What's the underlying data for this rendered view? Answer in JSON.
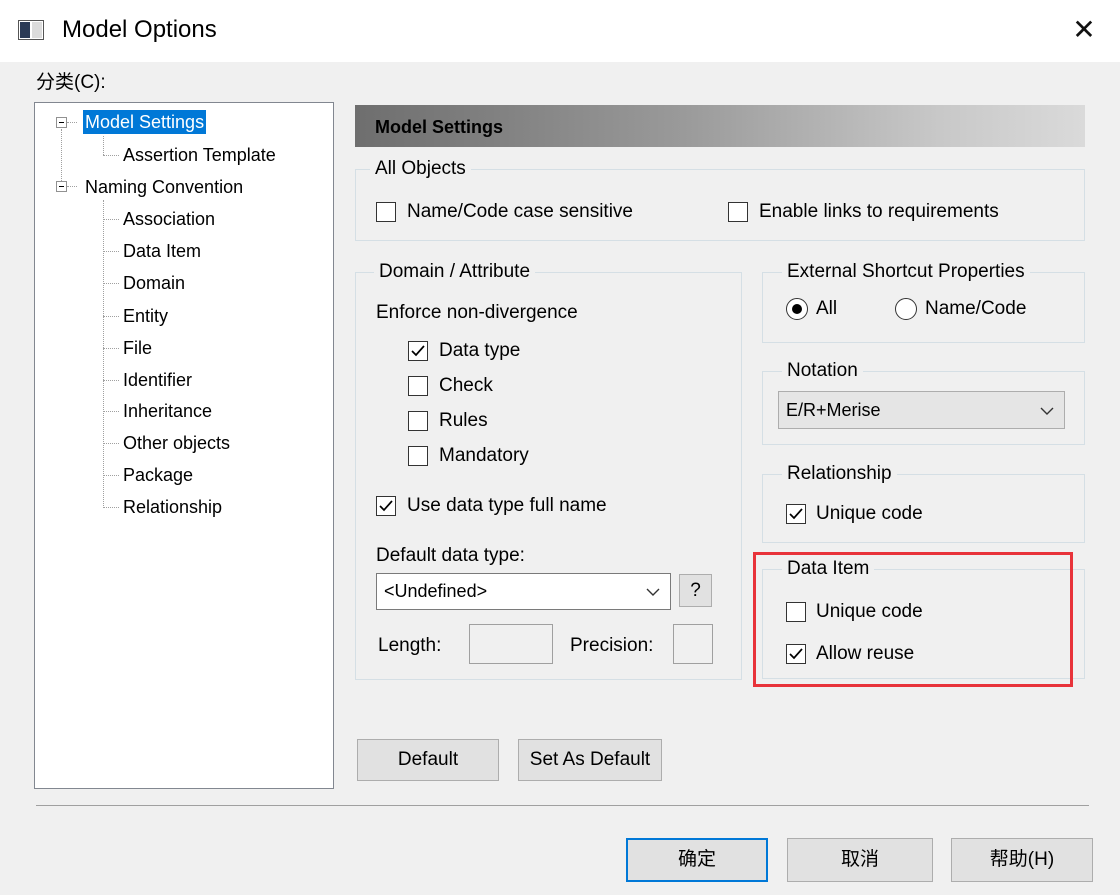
{
  "window": {
    "title": "Model Options",
    "close_glyph": "✕",
    "icon": "window-app-icon"
  },
  "category_label": "分类(C):",
  "tree": {
    "items": [
      {
        "label": "Model Settings",
        "level": 0,
        "expanded": true,
        "selected": true
      },
      {
        "label": "Assertion Template",
        "level": 1
      },
      {
        "label": "Naming Convention",
        "level": 0,
        "expanded": true
      },
      {
        "label": "Association",
        "level": 1
      },
      {
        "label": "Data Item",
        "level": 1
      },
      {
        "label": "Domain",
        "level": 1
      },
      {
        "label": "Entity",
        "level": 1
      },
      {
        "label": "File",
        "level": 1
      },
      {
        "label": "Identifier",
        "level": 1
      },
      {
        "label": "Inheritance",
        "level": 1
      },
      {
        "label": "Other objects",
        "level": 1
      },
      {
        "label": "Package",
        "level": 1
      },
      {
        "label": "Relationship",
        "level": 1
      }
    ]
  },
  "section_title": "Model Settings",
  "all_objects": {
    "title": "All Objects",
    "case_sensitive": {
      "label": "Name/Code case sensitive",
      "checked": false
    },
    "enable_links": {
      "label": "Enable links to requirements",
      "checked": false
    }
  },
  "domain_attribute": {
    "title": "Domain / Attribute",
    "enforce_label": "Enforce non-divergence",
    "data_type": {
      "label": "Data type",
      "checked": true
    },
    "check": {
      "label": "Check",
      "checked": false
    },
    "rules": {
      "label": "Rules",
      "checked": false
    },
    "mandatory": {
      "label": "Mandatory",
      "checked": false
    },
    "full_name": {
      "label": "Use data type full name",
      "checked": true
    },
    "default_type_label": "Default data type:",
    "default_type_value": "<Undefined>",
    "help_button": "?",
    "length_label": "Length:",
    "precision_label": "Precision:"
  },
  "external_shortcut": {
    "title": "External Shortcut Properties",
    "all_label": "All",
    "name_code_label": "Name/Code",
    "selected": "All"
  },
  "notation": {
    "title": "Notation",
    "value": "E/R+Merise"
  },
  "relationship": {
    "title": "Relationship",
    "unique_code": {
      "label": "Unique code",
      "checked": true
    }
  },
  "data_item": {
    "title": "Data Item",
    "unique_code": {
      "label": "Unique code",
      "checked": false
    },
    "allow_reuse": {
      "label": "Allow reuse",
      "checked": true
    }
  },
  "buttons": {
    "default": "Default",
    "set_as_default": "Set As Default",
    "ok": "确定",
    "cancel": "取消",
    "help": "帮助(H)"
  },
  "colors": {
    "selection": "#0078d7",
    "highlight_box": "#e8333a"
  }
}
